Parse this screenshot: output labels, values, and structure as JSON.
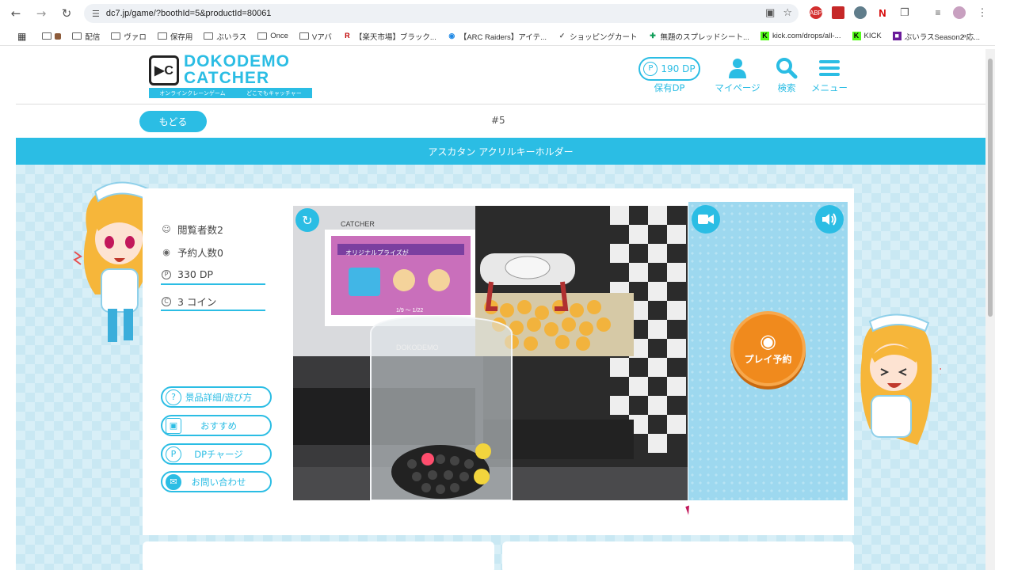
{
  "browser": {
    "url": "dc7.jp/game/?boothId=5&productId=80061",
    "bookmarks": [
      "配信",
      "ヴァロ",
      "保存用",
      "ぶいラス",
      "Once",
      "Vアバ",
      "【楽天市場】ブラック...",
      "【ARC Raiders】アイテ...",
      "ショッピングカート",
      "無題のスプレッドシート...",
      "kick.com/drops/all-...",
      "KICK",
      "ぶいラスSeason2 応..."
    ],
    "extensions": [
      "ABP",
      "ext-red",
      "ext-globe",
      "ext-n"
    ]
  },
  "header": {
    "logo_line1": "DOKODEMO",
    "logo_line2": "CATCHER",
    "logo_sub_left": "オンラインクレーンゲーム",
    "logo_sub_right": "どこでもキャッチャー",
    "dp_amount": "190 DP",
    "dp_label": "保有DP",
    "mypage_label": "マイページ",
    "search_label": "検索",
    "menu_label": "メニュー"
  },
  "subbar": {
    "back_label": "もどる",
    "booth_no": "#5"
  },
  "product_title": "アスカタン アクリルキーホルダー",
  "info": {
    "viewers": "閲覧者数2",
    "reservations": "予約人数0",
    "dp_cost": "330 DP",
    "coin_cost": "3 コイン"
  },
  "side_buttons": {
    "details": "景品詳細/遊び方",
    "recommend": "おすすめ",
    "dp_charge": "DPチャージ",
    "contact": "お問い合わせ"
  },
  "play": {
    "reserve_label": "プレイ予約"
  },
  "stream": {
    "poster_text": "オリジナルプライズが",
    "poster_date": "1/9 ～ 1/22",
    "machine_brand": "DOKODEMO",
    "machine_brand2": "CATCHER"
  },
  "colors": {
    "accent": "#2bbde4",
    "play_button": "#f08a1d",
    "panel_bg": "#9dd8ef"
  }
}
